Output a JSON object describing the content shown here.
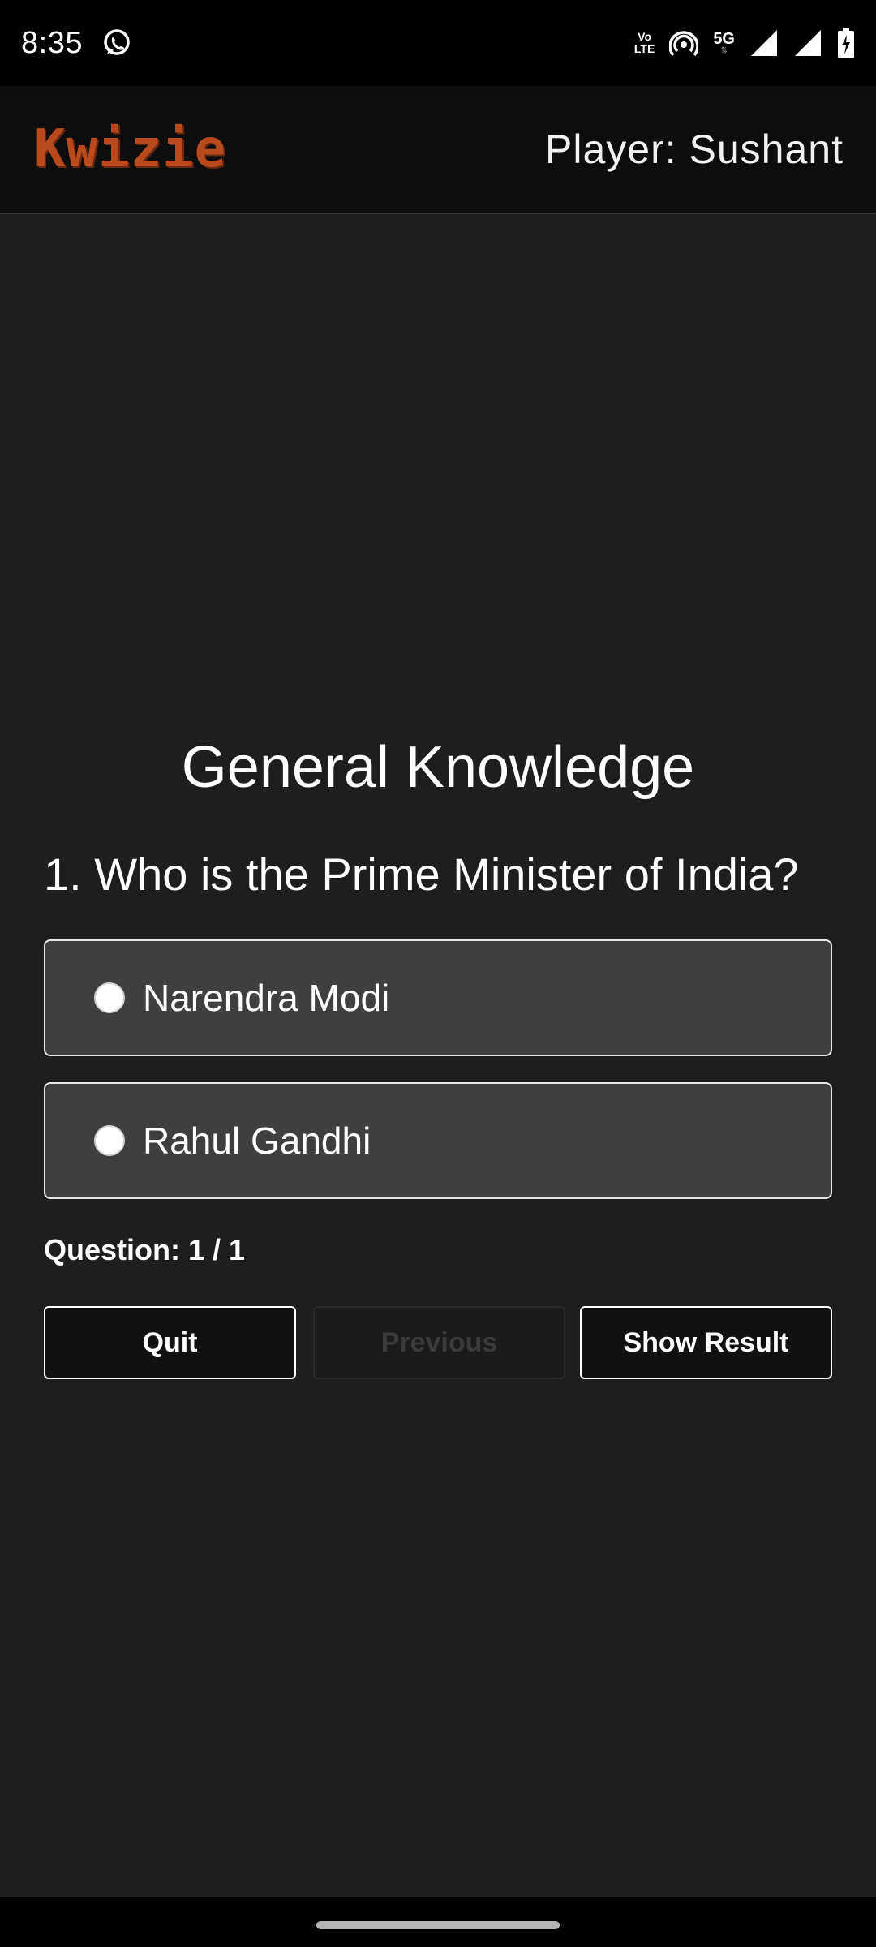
{
  "status_bar": {
    "time": "8:35",
    "volte_top": "Vo",
    "volte_bottom": "LTE",
    "network": "5G",
    "icons": [
      "whatsapp-icon",
      "hotspot-icon",
      "signal-icon",
      "signal-icon",
      "battery-charging-icon"
    ]
  },
  "header": {
    "logo_text": "Kwizie",
    "player_label": "Player: Sushant"
  },
  "quiz": {
    "title": "General Knowledge",
    "question": "1. Who is the Prime Minister of India?",
    "options": [
      {
        "label": "Narendra Modi",
        "selected": false
      },
      {
        "label": "Rahul Gandhi",
        "selected": false
      }
    ],
    "progress": "Question: 1 / 1"
  },
  "buttons": {
    "quit": "Quit",
    "previous": "Previous",
    "show_result": "Show Result"
  },
  "colors": {
    "logo": "#b84a1e",
    "background": "#1e1e1e",
    "option_bg": "#3f3f3f"
  }
}
